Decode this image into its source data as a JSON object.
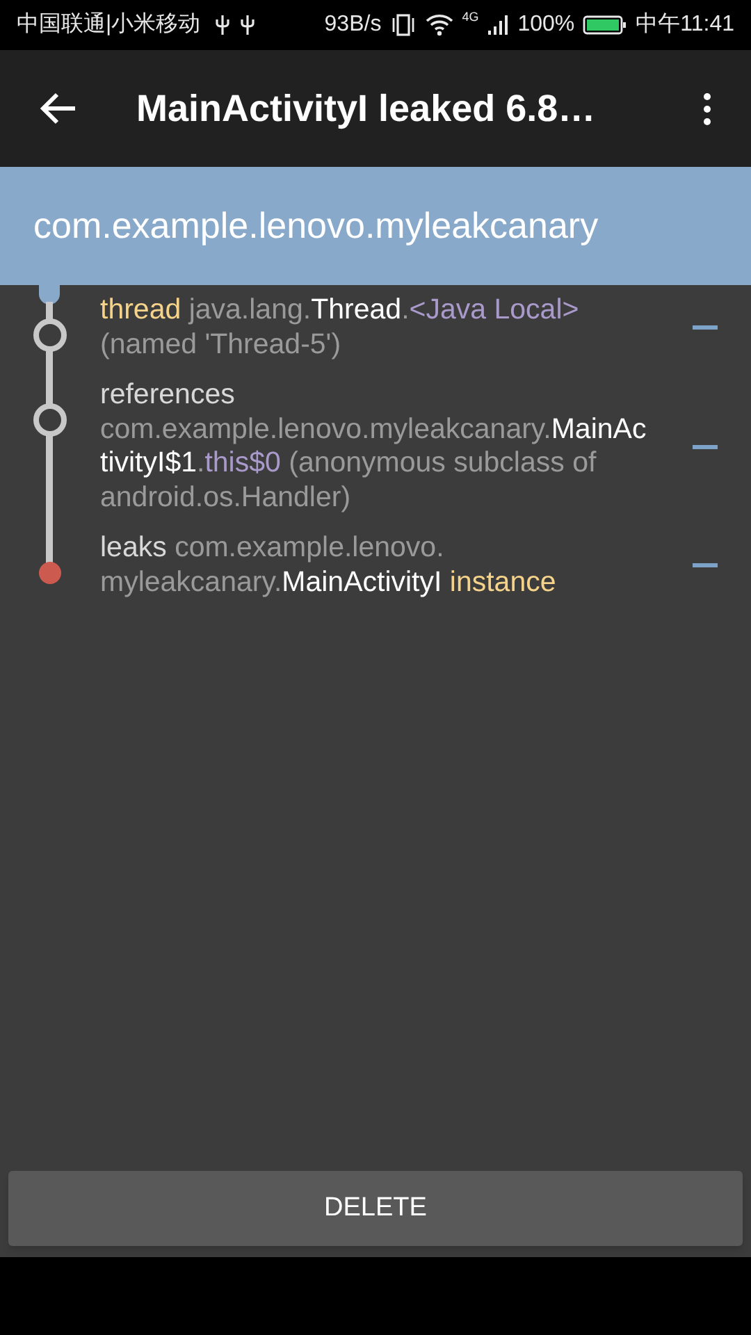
{
  "status_bar": {
    "carrier": "中国联通|小米移动",
    "speed": "93B/s",
    "network": "4G",
    "battery": "100%",
    "time": "中午11:41"
  },
  "toolbar": {
    "title": "MainActivityI leaked 6.8…"
  },
  "header": {
    "title": "com.example.lenovo.myleakcanary"
  },
  "trace": [
    {
      "kind": "reference",
      "segments": [
        {
          "kind": "keyword",
          "text": "thread "
        },
        {
          "kind": "package",
          "text": "java.lang."
        },
        {
          "kind": "class",
          "text": "Thread"
        },
        {
          "kind": "package",
          "text": "."
        },
        {
          "kind": "field",
          "text": "<Java Local>"
        },
        {
          "kind": "package",
          "text": " (named 'Thread-5')"
        }
      ]
    },
    {
      "kind": "reference",
      "segments": [
        {
          "kind": "label",
          "text": "references "
        },
        {
          "kind": "package",
          "text": "com.example.lenovo.myleakcanary."
        },
        {
          "kind": "class",
          "text": "MainActivityI$1"
        },
        {
          "kind": "package",
          "text": "."
        },
        {
          "kind": "field",
          "text": "this$0"
        },
        {
          "kind": "package",
          "text": " (anonymous subclass of android.os.Handler)"
        }
      ]
    },
    {
      "kind": "leak",
      "segments": [
        {
          "kind": "label",
          "text": "leaks "
        },
        {
          "kind": "package",
          "text": "com.example.lenovo. myleakcanary."
        },
        {
          "kind": "class",
          "text": "MainActivityI"
        },
        {
          "kind": "keyword",
          "text": " instance"
        }
      ]
    }
  ],
  "button": "DELETE"
}
